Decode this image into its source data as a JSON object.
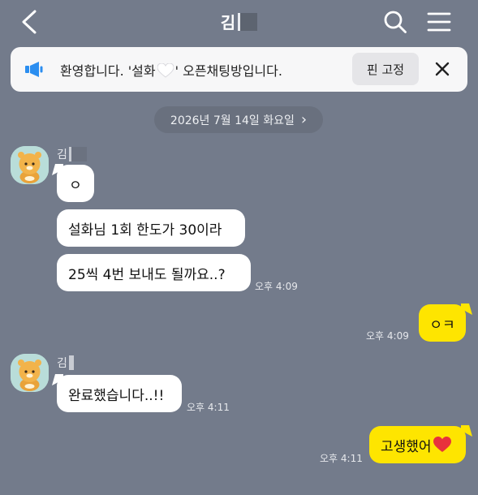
{
  "header": {
    "title": "김",
    "back_icon": "chevron-left-icon",
    "search_icon": "search-icon",
    "menu_icon": "hamburger-menu-icon"
  },
  "notice": {
    "text_before": "환영합니다. '설화",
    "text_after": "' 오픈채팅방입니다.",
    "pin_label": "핀 고정",
    "icon": "megaphone-icon",
    "close_icon": "close-icon"
  },
  "date_divider": {
    "label": "2026년 7월 14일 화요일",
    "chevron": "›"
  },
  "messages": [
    {
      "sender": "김",
      "text": "ㅇ"
    },
    {
      "text": "설화님 1회 한도가 30이라"
    },
    {
      "text": "25씩 4번 보내도 될까요..?",
      "time": "오후 4:09"
    },
    {
      "text": "ㅇㅋ",
      "time": "오후 4:09",
      "mine": true
    },
    {
      "sender": "김",
      "text": "완료했습니다..!!",
      "time": "오후 4:11"
    },
    {
      "text": "고생했어",
      "time": "오후 4:11",
      "mine": true
    }
  ],
  "colors": {
    "background": "#737b8b",
    "my_bubble": "#fee500",
    "other_bubble": "#ffffff",
    "notice_icon": "#2b8ef0",
    "heart": "#e8323c"
  }
}
